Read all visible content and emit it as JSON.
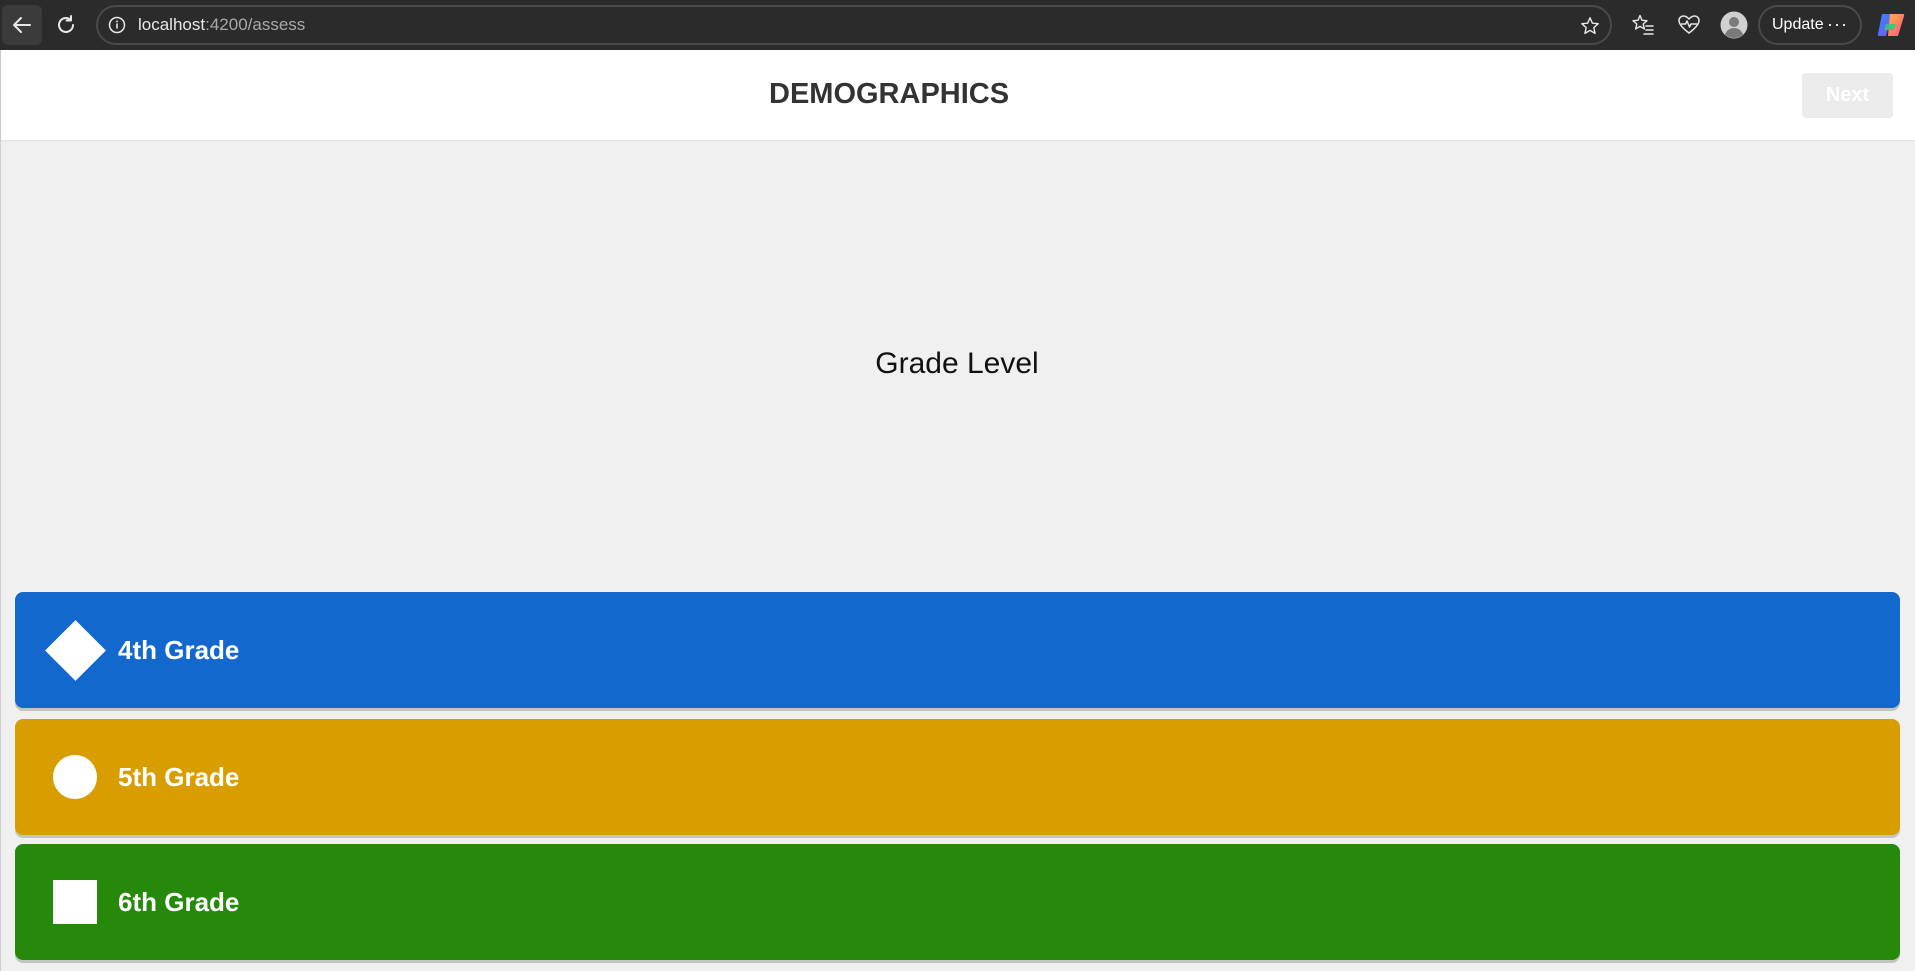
{
  "browser": {
    "url_host": "localhost",
    "url_path": ":4200/assess",
    "update_label": "Update",
    "more_label": "···",
    "icons": [
      "back-arrow-icon",
      "reload-icon",
      "info-icon",
      "star-icon",
      "favorites-icon",
      "health-icon",
      "profile-avatar-icon",
      "copilot-icon"
    ]
  },
  "header": {
    "title": "DEMOGRAPHICS",
    "next_label": "Next"
  },
  "question": {
    "text": "Grade Level"
  },
  "answers": [
    {
      "label": "4th Grade",
      "shape": "diamond",
      "color": "#1368ce"
    },
    {
      "label": "5th Grade",
      "shape": "circle",
      "color": "#d89e00"
    },
    {
      "label": "6th Grade",
      "shape": "square",
      "color": "#26890c"
    }
  ],
  "colors": {
    "browser_chrome": "#2b2b2b",
    "page_background": "#f0f0f0",
    "header_background": "#ffffff",
    "next_disabled": "#ebebeb"
  }
}
